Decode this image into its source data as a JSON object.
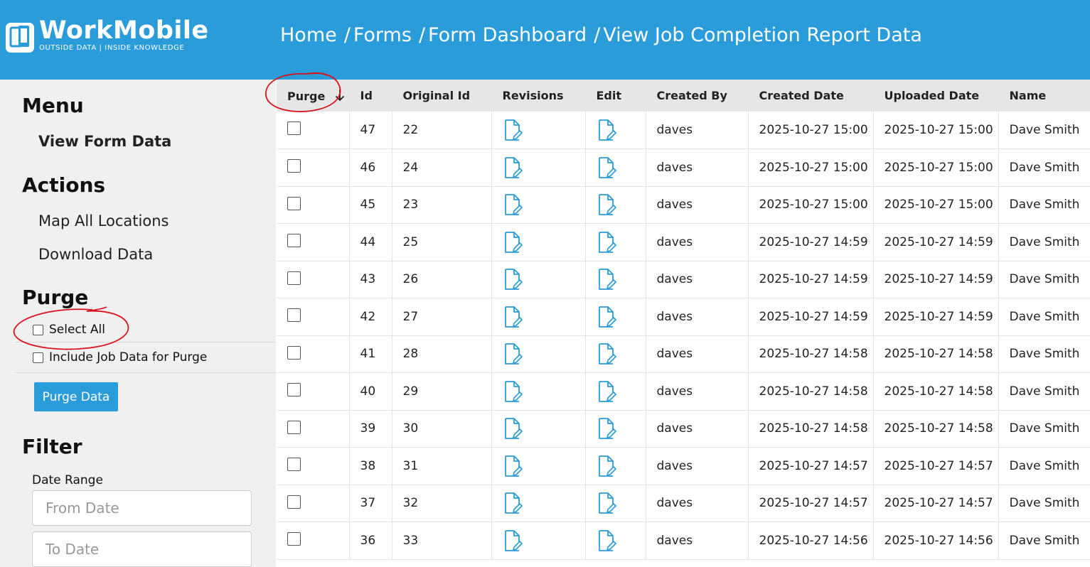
{
  "header": {
    "logo": {
      "name": "WorkMobile",
      "tagline": "OUTSIDE DATA | INSIDE KNOWLEDGE"
    },
    "breadcrumb": [
      {
        "label": "Home",
        "sep": ""
      },
      {
        "label": "Forms",
        "sep": "/"
      },
      {
        "label": "Form Dashboard",
        "sep": "/"
      },
      {
        "label": "View Job Completion Report Data",
        "sep": "/"
      }
    ]
  },
  "sidebar": {
    "menu_title": "Menu",
    "menu_items": [
      "View Form Data"
    ],
    "actions_title": "Actions",
    "action_items": [
      "Map All Locations",
      "Download Data"
    ],
    "purge_title": "Purge",
    "select_all_label": "Select All",
    "include_job_label": "Include Job Data for Purge",
    "purge_button": "Purge Data",
    "filter_title": "Filter",
    "date_range_label": "Date Range",
    "from_placeholder": "From Date",
    "to_placeholder": "To Date"
  },
  "table": {
    "columns": [
      "Purge",
      "Id",
      "Original Id",
      "Revisions",
      "Edit",
      "Created By",
      "Created Date",
      "Uploaded Date",
      "Name"
    ],
    "rows": [
      {
        "id": "47",
        "original_id": "22",
        "created_by": "daves",
        "created_date": "2025-10-27 15:00",
        "uploaded_date": "2025-10-27 15:00",
        "name": "Dave Smith"
      },
      {
        "id": "46",
        "original_id": "24",
        "created_by": "daves",
        "created_date": "2025-10-27 15:00",
        "uploaded_date": "2025-10-27 15:00",
        "name": "Dave Smith"
      },
      {
        "id": "45",
        "original_id": "23",
        "created_by": "daves",
        "created_date": "2025-10-27 15:00",
        "uploaded_date": "2025-10-27 15:00",
        "name": "Dave Smith"
      },
      {
        "id": "44",
        "original_id": "25",
        "created_by": "daves",
        "created_date": "2025-10-27 14:59",
        "uploaded_date": "2025-10-27 14:59",
        "name": "Dave Smith"
      },
      {
        "id": "43",
        "original_id": "26",
        "created_by": "daves",
        "created_date": "2025-10-27 14:59",
        "uploaded_date": "2025-10-27 14:59",
        "name": "Dave Smith"
      },
      {
        "id": "42",
        "original_id": "27",
        "created_by": "daves",
        "created_date": "2025-10-27 14:59",
        "uploaded_date": "2025-10-27 14:59",
        "name": "Dave Smith"
      },
      {
        "id": "41",
        "original_id": "28",
        "created_by": "daves",
        "created_date": "2025-10-27 14:58",
        "uploaded_date": "2025-10-27 14:58",
        "name": "Dave Smith"
      },
      {
        "id": "40",
        "original_id": "29",
        "created_by": "daves",
        "created_date": "2025-10-27 14:58",
        "uploaded_date": "2025-10-27 14:58",
        "name": "Dave Smith"
      },
      {
        "id": "39",
        "original_id": "30",
        "created_by": "daves",
        "created_date": "2025-10-27 14:58",
        "uploaded_date": "2025-10-27 14:58",
        "name": "Dave Smith"
      },
      {
        "id": "38",
        "original_id": "31",
        "created_by": "daves",
        "created_date": "2025-10-27 14:57",
        "uploaded_date": "2025-10-27 14:57",
        "name": "Dave Smith"
      },
      {
        "id": "37",
        "original_id": "32",
        "created_by": "daves",
        "created_date": "2025-10-27 14:57",
        "uploaded_date": "2025-10-27 14:57",
        "name": "Dave Smith"
      },
      {
        "id": "36",
        "original_id": "33",
        "created_by": "daves",
        "created_date": "2025-10-27 14:56",
        "uploaded_date": "2025-10-27 14:56",
        "name": "Dave Smith"
      }
    ]
  },
  "colors": {
    "brand": "#2a9cd9",
    "sidebar_bg": "#f0f0f0",
    "header_row_bg": "#e6e6e6",
    "annotation": "#d9121b"
  },
  "icons": {
    "revisions": "document-edit-icon",
    "edit": "document-edit-icon",
    "sort": "arrow-down-icon"
  }
}
